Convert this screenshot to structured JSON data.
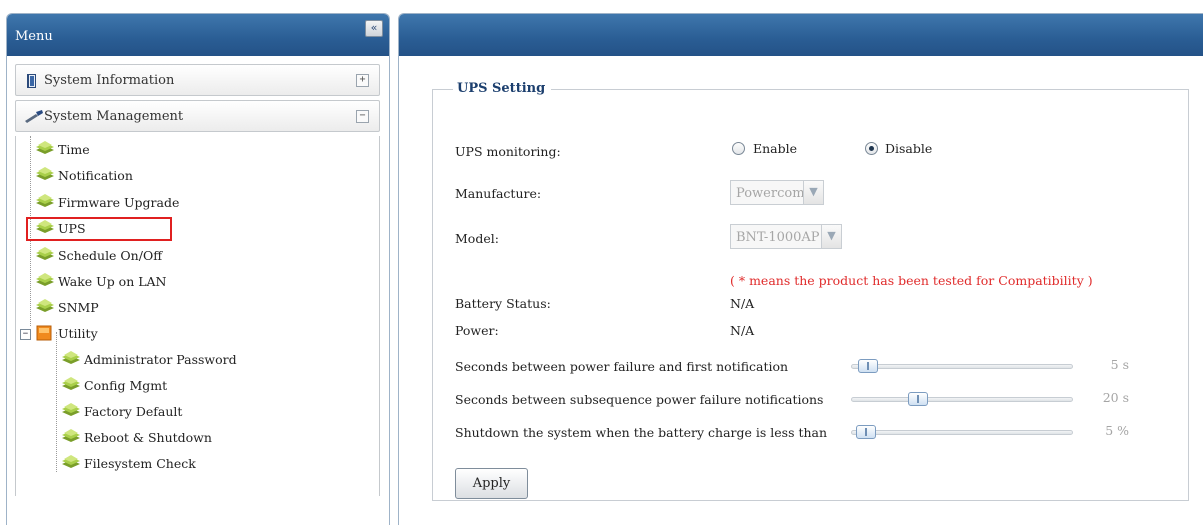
{
  "menu": {
    "title": "Menu",
    "collapse_label": "«",
    "sections": {
      "system_information": {
        "label": "System Information",
        "toggle": "+"
      },
      "system_management": {
        "label": "System Management",
        "toggle": "−"
      }
    },
    "items": {
      "time": "Time",
      "notification": "Notification",
      "firmware_upgrade": "Firmware Upgrade",
      "ups": "UPS",
      "schedule": "Schedule On/Off",
      "wol": "Wake Up on LAN",
      "snmp": "SNMP"
    },
    "utility": {
      "label": "Utility",
      "expander": "−",
      "items": {
        "admin_password": "Administrator Password",
        "config_mgmt": "Config Mgmt",
        "factory_default": "Factory Default",
        "reboot": "Reboot & Shutdown",
        "fs_check": "Filesystem Check"
      }
    },
    "selected": "UPS"
  },
  "ups": {
    "legend": "UPS Setting",
    "monitoring_label": "UPS monitoring:",
    "enable_label": "Enable",
    "disable_label": "Disable",
    "monitoring_value": "Disable",
    "manufacture_label": "Manufacture:",
    "manufacture_value": "Powercom",
    "model_label": "Model:",
    "model_value": "BNT-1000AP",
    "compat_note": "( * means the product has been tested for Compatibility )",
    "battery_label": "Battery Status:",
    "battery_value": "N/A",
    "power_label": "Power:",
    "power_value": "N/A",
    "slider_first_label": "Seconds between power failure and first notification",
    "slider_first_value": "5 s",
    "slider_first_fraction": 0.03,
    "slider_subsequent_label": "Seconds between subsequence power failure notifications",
    "slider_subsequent_value": "20 s",
    "slider_subsequent_fraction": 0.28,
    "slider_battery_label": "Shutdown the system when the battery charge is less than",
    "slider_battery_value": "5 %",
    "slider_battery_fraction": 0.02,
    "apply_label": "Apply"
  },
  "colors": {
    "header_blue": "#2a5d94",
    "highlight_red": "#e02020",
    "note_red": "#e02b2b",
    "legend_blue": "#1c3f6e"
  }
}
